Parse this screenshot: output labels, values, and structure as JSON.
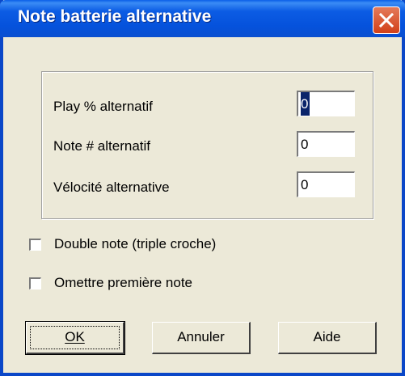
{
  "window": {
    "title": "Note batterie alternative"
  },
  "fields": [
    {
      "label": "Play % alternatif",
      "value": "0"
    },
    {
      "label": "Note # alternatif",
      "value": "0"
    },
    {
      "label": "Vélocité alternative",
      "value": "0"
    }
  ],
  "checkboxes": [
    {
      "label": "Double note (triple croche)",
      "checked": false
    },
    {
      "label": "Omettre première note",
      "checked": false
    }
  ],
  "buttons": {
    "ok": "OK",
    "cancel": "Annuler",
    "help": "Aide"
  }
}
